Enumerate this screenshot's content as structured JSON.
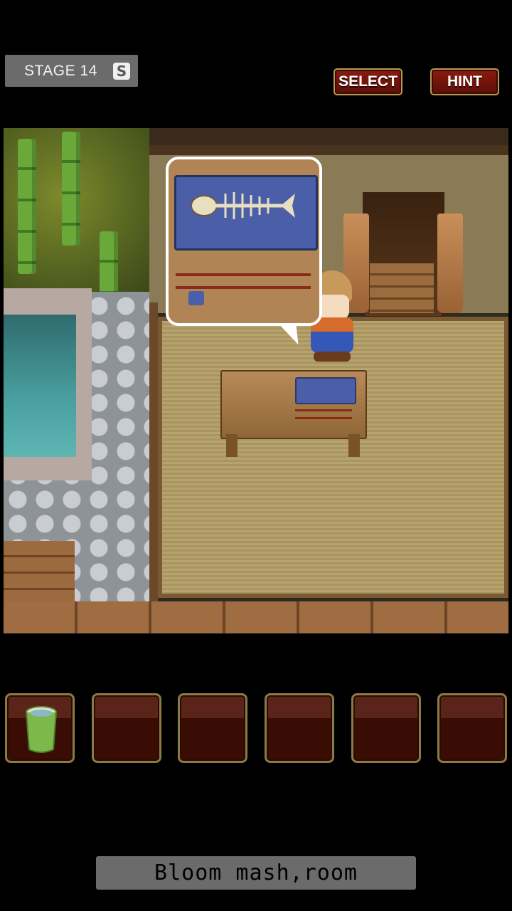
{
  "header": {
    "stage_label": "STAGE 14",
    "save_icon": "save-icon",
    "save_glyph": "S",
    "select_label": "SELECT",
    "hint_label": "HINT"
  },
  "scene": {
    "description_items": [
      "fish-skeleton-plate",
      "chopsticks",
      "character",
      "low-table",
      "pool",
      "bamboo"
    ]
  },
  "inventory": {
    "slots": [
      {
        "item": "bamboo-bucket"
      },
      {
        "item": ""
      },
      {
        "item": ""
      },
      {
        "item": ""
      },
      {
        "item": ""
      },
      {
        "item": ""
      }
    ]
  },
  "footer": {
    "message": "Bloom mash,room"
  },
  "colors": {
    "button_red": "#7a1a0e",
    "button_border": "#b79a54",
    "slot_border": "#8a7a44",
    "badge_gray": "#6b6b6b"
  }
}
